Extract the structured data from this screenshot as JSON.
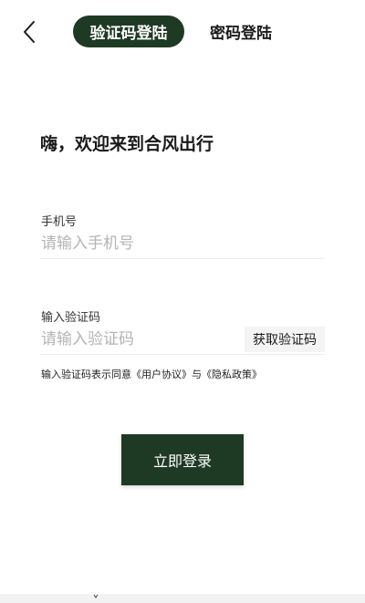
{
  "header": {
    "tabs": [
      {
        "label": "验证码登陆",
        "active": true
      },
      {
        "label": "密码登陆",
        "active": false
      }
    ]
  },
  "main": {
    "welcome": "嗨，欢迎来到合风出行",
    "phone": {
      "label": "手机号",
      "placeholder": "请输入手机号",
      "value": ""
    },
    "code": {
      "label": "输入验证码",
      "placeholder": "请输入验证码",
      "value": "",
      "get_code_label": "获取验证码"
    },
    "agreement": {
      "prefix": "输入验证码表示同意",
      "user_agreement": "《用户协议》",
      "conjunction": "与",
      "privacy_policy": "《隐私政策》"
    },
    "login_label": "立即登录"
  },
  "icons": {
    "back": "chevron-left-icon"
  },
  "colors": {
    "primary": "#1f3a24",
    "placeholder": "#b4b4b4",
    "text": "#1a1a1a"
  }
}
